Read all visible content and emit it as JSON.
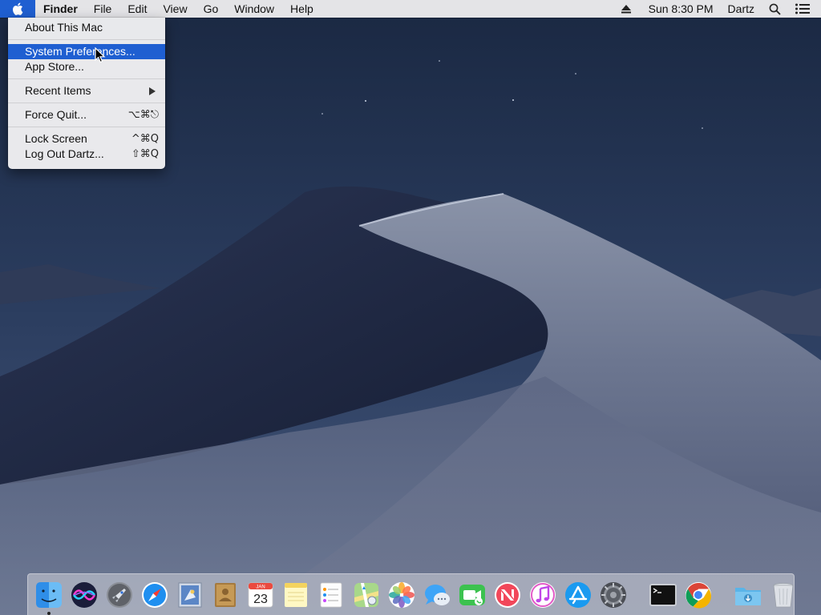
{
  "menubar": {
    "apple_icon": "apple-icon",
    "items": [
      {
        "label": "Finder",
        "bold": true
      },
      {
        "label": "File"
      },
      {
        "label": "Edit"
      },
      {
        "label": "View"
      },
      {
        "label": "Go"
      },
      {
        "label": "Window"
      },
      {
        "label": "Help"
      }
    ],
    "right": {
      "eject_icon": "eject-icon",
      "clock": "Sun 8:30 PM",
      "user": "Dartz",
      "search_icon": "spotlight-search-icon",
      "notification_icon": "notification-center-icon"
    }
  },
  "apple_menu": {
    "about": "About This Mac",
    "system_prefs": "System Preferences...",
    "app_store": "App Store...",
    "recent_items": "Recent Items",
    "force_quit": "Force Quit...",
    "force_quit_shortcut": "⌥⌘⎋",
    "lock_screen": "Lock Screen",
    "lock_screen_shortcut": "^⌘Q",
    "log_out": "Log Out Dartz...",
    "log_out_shortcut": "⇧⌘Q",
    "highlight_color": "#1f5fd1"
  },
  "calendar": {
    "month": "JAN",
    "day": "23"
  },
  "dock": {
    "apps": [
      "finder",
      "siri",
      "launchpad",
      "safari",
      "mail",
      "contacts",
      "calendar",
      "notes",
      "reminders",
      "maps",
      "photos",
      "messages",
      "facetime",
      "news",
      "itunes",
      "app-store",
      "system-preferences"
    ],
    "recent": [
      "terminal",
      "chrome"
    ],
    "extras": [
      "downloads",
      "trash"
    ]
  }
}
